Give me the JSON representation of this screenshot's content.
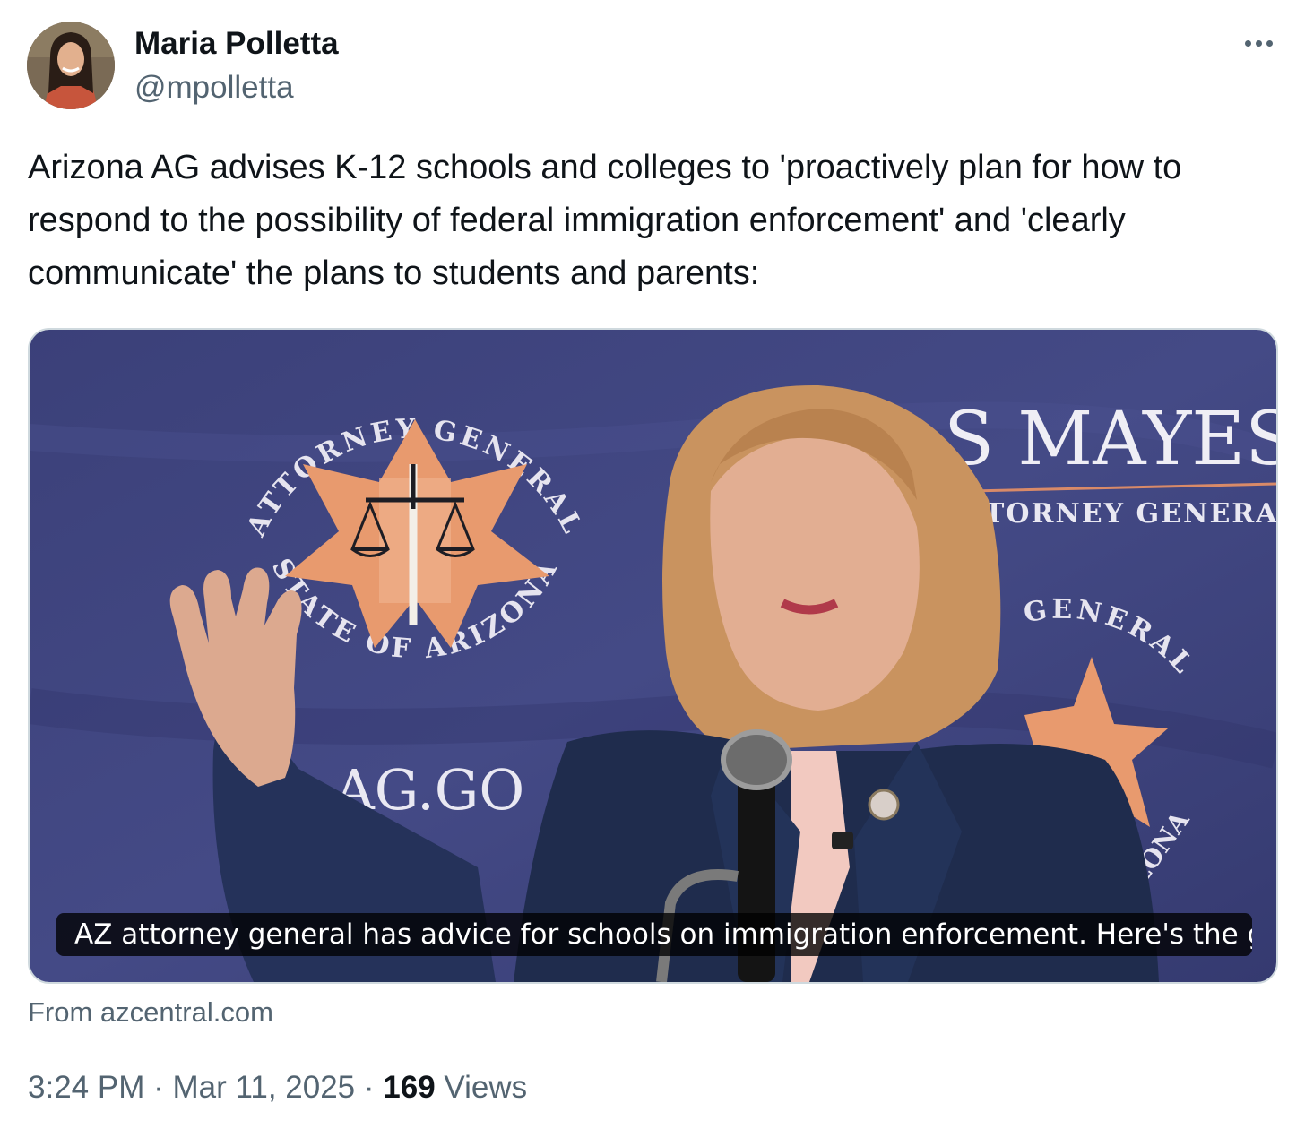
{
  "tweet": {
    "author": {
      "display_name": "Maria Polletta",
      "handle": "@mpolletta"
    },
    "more_icon": "more-horizontal-icon",
    "text": "Arizona AG advises K-12 schools and colleges to 'proactively plan for how to respond to the possibility of federal immigration enforcement' and 'clearly communicate' the plans to students and parents:",
    "card": {
      "caption": "AZ attorney general has advice for schools on immigration enforcement. Here's the gui…",
      "source": "From azcentral.com",
      "image": {
        "seal_top_text": "ATTORNEY GENERAL",
        "seal_bottom_text": "STATE OF ARIZONA",
        "banner_site": "AG.GO",
        "banner_name": "S MAYES",
        "banner_title": "TORNEY GENERAL",
        "seal2_top_text": "Y GENERAL",
        "seal2_bottom_text": "ZONA"
      }
    },
    "meta": {
      "time": "3:24 PM",
      "separator": "·",
      "date": "Mar 11, 2025",
      "views_count": "169",
      "views_label": "Views"
    },
    "colors": {
      "text_primary": "#0f1419",
      "text_secondary": "#536471",
      "border": "#cfd9de",
      "banner_blue": "#3a3f78",
      "seal_orange": "#e89a6e"
    }
  }
}
